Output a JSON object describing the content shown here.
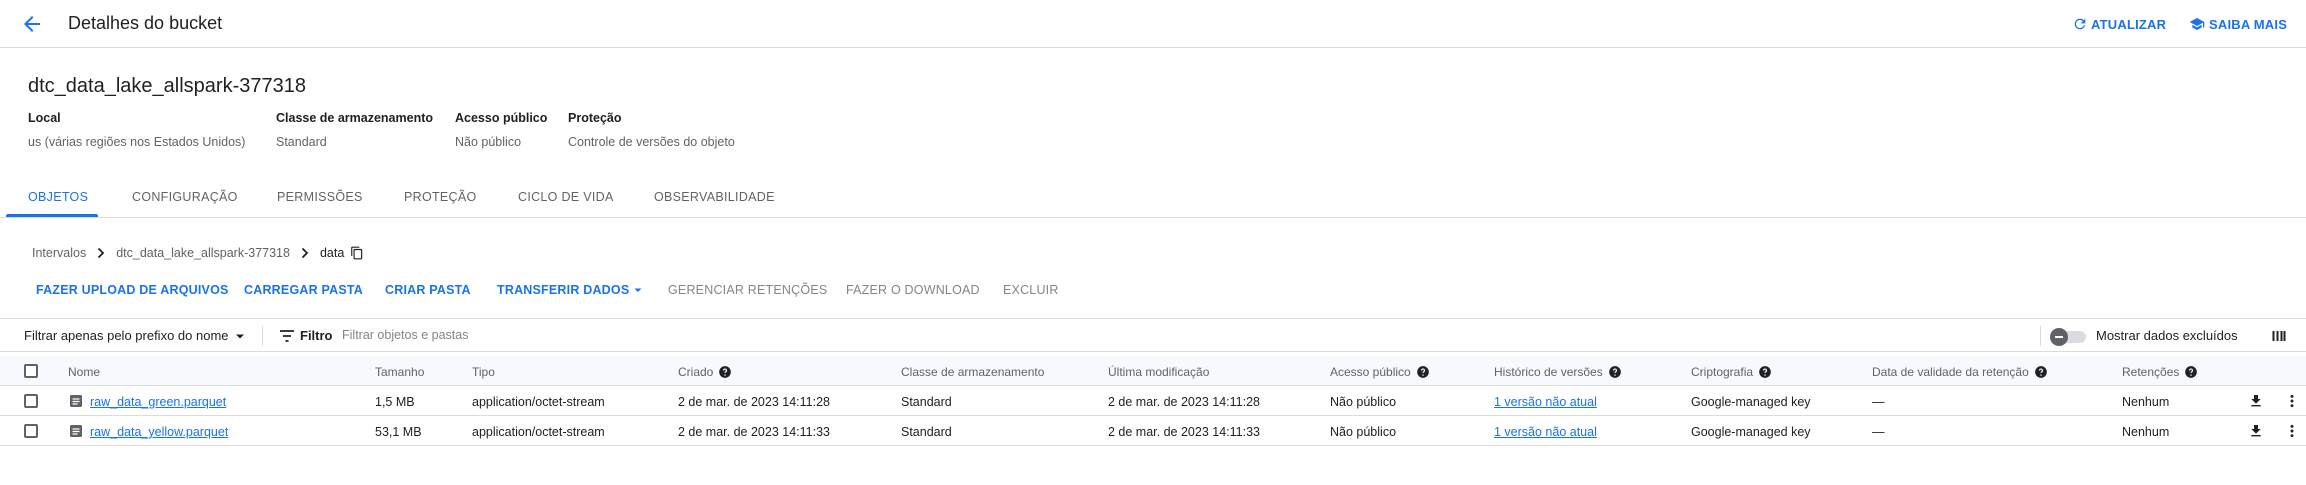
{
  "header": {
    "title": "Detalhes do bucket",
    "refresh_label": "ATUALIZAR",
    "learn_label": "SAIBA MAIS"
  },
  "bucket": {
    "name": "dtc_data_lake_allspark-377318",
    "properties": [
      {
        "label": "Local",
        "value": "us (várias regiões nos Estados Unidos)"
      },
      {
        "label": "Classe de armazenamento",
        "value": "Standard"
      },
      {
        "label": "Acesso público",
        "value": "Não público"
      },
      {
        "label": "Proteção",
        "value": "Controle de versões do objeto"
      }
    ]
  },
  "tabs": [
    {
      "label": "OBJETOS",
      "active": true
    },
    {
      "label": "CONFIGURAÇÃO",
      "active": false
    },
    {
      "label": "PERMISSÕES",
      "active": false
    },
    {
      "label": "PROTEÇÃO",
      "active": false
    },
    {
      "label": "CICLO DE VIDA",
      "active": false
    },
    {
      "label": "OBSERVABILIDADE",
      "active": false
    }
  ],
  "breadcrumb": [
    "Intervalos",
    "dtc_data_lake_allspark-377318",
    "data"
  ],
  "actions": {
    "upload_files": "FAZER UPLOAD DE ARQUIVOS",
    "upload_folder": "CARREGAR PASTA",
    "create_folder": "CRIAR PASTA",
    "transfer_data": "TRANSFERIR DADOS",
    "manage_retention": "GERENCIAR RETENÇÕES",
    "download": "FAZER O DOWNLOAD",
    "delete": "EXCLUIR"
  },
  "filter": {
    "prefix_label": "Filtrar apenas pelo prefixo do nome",
    "filter_label": "Filtro",
    "placeholder": "Filtrar objetos e pastas",
    "show_deleted_label": "Mostrar dados excluídos"
  },
  "table": {
    "columns": [
      "Nome",
      "Tamanho",
      "Tipo",
      "Criado",
      "Classe de armazenamento",
      "Última modificação",
      "Acesso público",
      "Histórico de versões",
      "Criptografia",
      "Data de validade da retenção",
      "Retenções"
    ],
    "rows": [
      {
        "name": "raw_data_green.parquet",
        "size": "1,5 MB",
        "type": "application/octet-stream",
        "created": "2 de mar. de 2023 14:11:28",
        "storage_class": "Standard",
        "modified": "2 de mar. de 2023 14:11:28",
        "public_access": "Não público",
        "versions": "1 versão não atual",
        "encryption": "Google-managed key",
        "retention_date": "—",
        "holds": "Nenhum"
      },
      {
        "name": "raw_data_yellow.parquet",
        "size": "53,1 MB",
        "type": "application/octet-stream",
        "created": "2 de mar. de 2023 14:11:33",
        "storage_class": "Standard",
        "modified": "2 de mar. de 2023 14:11:33",
        "public_access": "Não público",
        "versions": "1 versão não atual",
        "encryption": "Google-managed key",
        "retention_date": "—",
        "holds": "Nenhum"
      }
    ]
  },
  "colors": {
    "accent": "#1a73e8",
    "text": "#202124",
    "muted": "#5f6368",
    "divider": "#dadce0"
  }
}
